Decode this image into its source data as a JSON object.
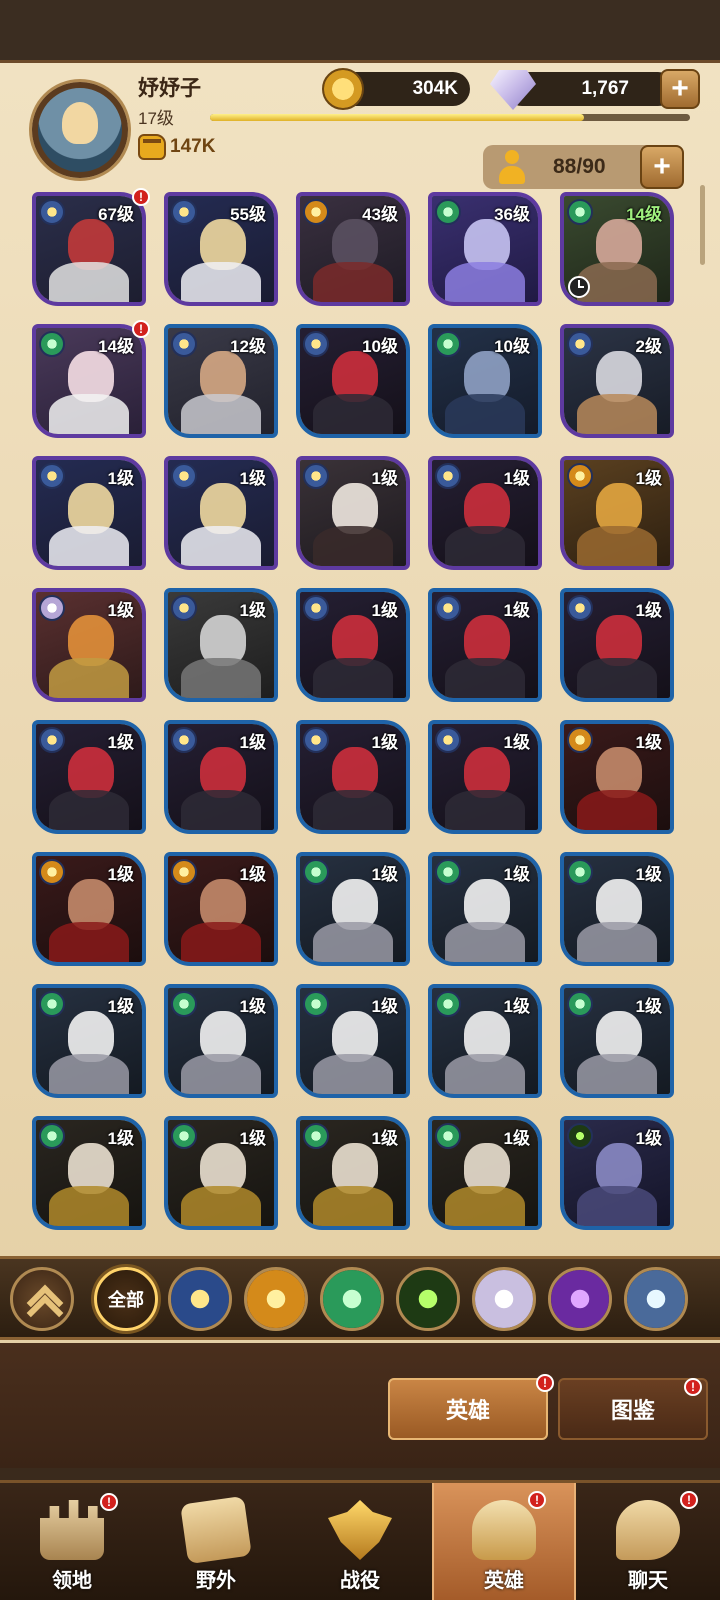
{
  "player": {
    "name": "妤妤子",
    "level": "17级",
    "xp_fraction": 0.78,
    "power": "147K"
  },
  "resources": {
    "gold": "304K",
    "diamonds": "1,767",
    "hero_slots": "88/90",
    "plus_label": "+"
  },
  "heroes": [
    {
      "level": "67级",
      "tier": "purple",
      "faction": "celestial",
      "portrait": "red-hair-girl",
      "alert": true
    },
    {
      "level": "55级",
      "tier": "purple",
      "faction": "celestial",
      "portrait": "blonde-girl",
      "alert": false
    },
    {
      "level": "43级",
      "tier": "purple",
      "faction": "lightbearer",
      "portrait": "wolf-warrior",
      "alert": false
    },
    {
      "level": "36级",
      "tier": "purple",
      "faction": "wilder",
      "portrait": "spirit-beast",
      "alert": false
    },
    {
      "level": "14级",
      "tier": "purple",
      "faction": "wilder",
      "portrait": "horned-ogre",
      "alert": false,
      "clock": true,
      "green": true
    },
    {
      "level": "14级",
      "tier": "purple",
      "faction": "wilder",
      "portrait": "lamb-girl",
      "alert": true
    },
    {
      "level": "12级",
      "tier": "blue",
      "faction": "celestial",
      "portrait": "bearded-knight",
      "alert": false
    },
    {
      "level": "10级",
      "tier": "blue",
      "faction": "celestial",
      "portrait": "red-witch",
      "alert": false
    },
    {
      "level": "10级",
      "tier": "blue",
      "faction": "wilder",
      "portrait": "shadow-elf",
      "alert": false
    },
    {
      "level": "2级",
      "tier": "purple",
      "faction": "celestial",
      "portrait": "hooded-assassin",
      "alert": false
    },
    {
      "level": "1级",
      "tier": "purple",
      "faction": "celestial",
      "portrait": "blonde-girl",
      "alert": false
    },
    {
      "level": "1级",
      "tier": "purple",
      "faction": "celestial",
      "portrait": "blonde-girl",
      "alert": false
    },
    {
      "level": "1级",
      "tier": "purple",
      "faction": "celestial",
      "portrait": "white-hair-elf",
      "alert": false
    },
    {
      "level": "1级",
      "tier": "purple",
      "faction": "celestial",
      "portrait": "red-witch",
      "alert": false
    },
    {
      "level": "1级",
      "tier": "purple",
      "faction": "lightbearer",
      "portrait": "lion-beast",
      "alert": false
    },
    {
      "level": "1级",
      "tier": "purple",
      "faction": "hypogean",
      "portrait": "monkey-king",
      "alert": false
    },
    {
      "level": "1级",
      "tier": "blue",
      "faction": "celestial",
      "portrait": "old-sage",
      "alert": false
    },
    {
      "level": "1级",
      "tier": "blue",
      "faction": "celestial",
      "portrait": "red-witch",
      "alert": false
    },
    {
      "level": "1级",
      "tier": "blue",
      "faction": "celestial",
      "portrait": "red-witch",
      "alert": false
    },
    {
      "level": "1级",
      "tier": "blue",
      "faction": "celestial",
      "portrait": "red-witch",
      "alert": false
    },
    {
      "level": "1级",
      "tier": "blue",
      "faction": "celestial",
      "portrait": "red-witch",
      "alert": false
    },
    {
      "level": "1级",
      "tier": "blue",
      "faction": "celestial",
      "portrait": "red-witch",
      "alert": false
    },
    {
      "level": "1级",
      "tier": "blue",
      "faction": "celestial",
      "portrait": "red-witch",
      "alert": false
    },
    {
      "level": "1级",
      "tier": "blue",
      "faction": "celestial",
      "portrait": "red-witch",
      "alert": false
    },
    {
      "level": "1级",
      "tier": "blue",
      "faction": "lightbearer",
      "portrait": "dancer",
      "alert": false
    },
    {
      "level": "1级",
      "tier": "blue",
      "faction": "lightbearer",
      "portrait": "dancer",
      "alert": false
    },
    {
      "level": "1级",
      "tier": "blue",
      "faction": "lightbearer",
      "portrait": "dancer",
      "alert": false
    },
    {
      "level": "1级",
      "tier": "blue",
      "faction": "wilder",
      "portrait": "ghost-mask",
      "alert": false
    },
    {
      "level": "1级",
      "tier": "blue",
      "faction": "wilder",
      "portrait": "ghost-mask",
      "alert": false
    },
    {
      "level": "1级",
      "tier": "blue",
      "faction": "wilder",
      "portrait": "ghost-mask",
      "alert": false
    },
    {
      "level": "1级",
      "tier": "blue",
      "faction": "wilder",
      "portrait": "ghost-mask",
      "alert": false
    },
    {
      "level": "1级",
      "tier": "blue",
      "faction": "wilder",
      "portrait": "ghost-mask",
      "alert": false
    },
    {
      "level": "1级",
      "tier": "blue",
      "faction": "wilder",
      "portrait": "ghost-mask",
      "alert": false
    },
    {
      "level": "1级",
      "tier": "blue",
      "faction": "wilder",
      "portrait": "ghost-mask",
      "alert": false
    },
    {
      "level": "1级",
      "tier": "blue",
      "faction": "wilder",
      "portrait": "ghost-mask",
      "alert": false
    },
    {
      "level": "1级",
      "tier": "blue",
      "faction": "wilder",
      "portrait": "tribal-chief",
      "alert": false
    },
    {
      "level": "1级",
      "tier": "blue",
      "faction": "wilder",
      "portrait": "tribal-chief",
      "alert": false
    },
    {
      "level": "1级",
      "tier": "blue",
      "faction": "wilder",
      "portrait": "tribal-chief",
      "alert": false
    },
    {
      "level": "1级",
      "tier": "blue",
      "faction": "wilder",
      "portrait": "tribal-chief",
      "alert": false
    },
    {
      "level": "1级",
      "tier": "blue",
      "faction": "graveborn",
      "portrait": "dark-elf",
      "alert": false
    }
  ],
  "filters": {
    "all_label": "全部",
    "factions": [
      "celestial",
      "lightbearer",
      "wilder",
      "graveborn",
      "hypogean",
      "mauler",
      "dimensional"
    ]
  },
  "sub_tabs": {
    "heroes": "英雄",
    "codex": "图鉴"
  },
  "bottom_nav": [
    {
      "label": "领地",
      "icon": "castle-icon",
      "alert": true
    },
    {
      "label": "野外",
      "icon": "scroll-icon",
      "alert": false
    },
    {
      "label": "战役",
      "icon": "battle-icon",
      "alert": false
    },
    {
      "label": "英雄",
      "icon": "helmet-icon",
      "alert": true,
      "active": true
    },
    {
      "label": "聊天",
      "icon": "chat-icon",
      "alert": true
    }
  ],
  "alert_mark": "!"
}
